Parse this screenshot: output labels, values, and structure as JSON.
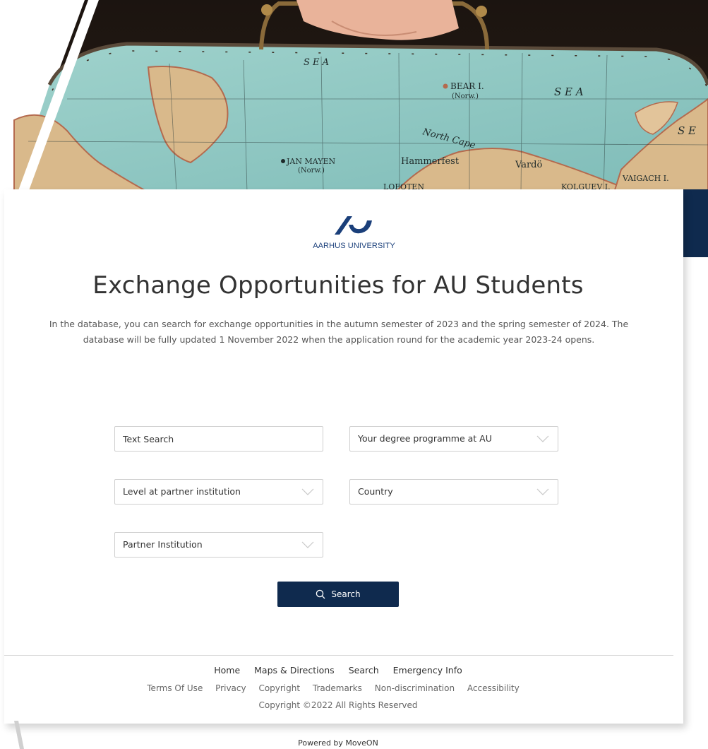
{
  "hero": {
    "image_description_icon": "vintage-map-suitcase-image",
    "map_labels": {
      "sea_top": "S E A",
      "bear_island": "BEAR I.",
      "bear_island_sub": "(Norw.)",
      "sea_right": "S E A",
      "se_right": "S E",
      "north_cape": "North Cape",
      "jan_mayen": "JAN MAYEN",
      "jan_mayen_sub": "(Norw.)",
      "hammerfest": "Hammerfest",
      "vardo": "Vardö",
      "vaigach": "VAIGACH I.",
      "lofoten": "LOFOTEN",
      "kolguev": "KOLGUEV I."
    }
  },
  "brand": {
    "logo_icon": "aarhus-university-logo-icon",
    "name": "AARHUS UNIVERSITY"
  },
  "page": {
    "title": "Exchange Opportunities for AU Students",
    "intro": "In the database, you can search for exchange opportunities in the autumn semester of 2023 and the spring semester of 2024. The database will be fully updated 1 November 2022 when the application round for the academic year 2023-24 opens."
  },
  "search": {
    "text_placeholder": "Text Search",
    "degree_programme": "Your degree programme at AU",
    "level": "Level at partner institution",
    "country": "Country",
    "partner_institution": "Partner Institution",
    "button_label": "Search",
    "button_icon": "search-icon",
    "dropdown_icon": "chevron-down-icon"
  },
  "footer": {
    "nav": [
      "Home",
      "Maps & Directions",
      "Search",
      "Emergency Info"
    ],
    "legal": [
      "Terms Of Use",
      "Privacy",
      "Copyright",
      "Trademarks",
      "Non-discrimination",
      "Accessibility"
    ],
    "copyright": "Copyright ©2022 All Rights Reserved",
    "powered_by": "Powered by MoveON"
  },
  "colors": {
    "brand_navy": "#0f2a4e",
    "logo_blue": "#1a3f7a",
    "map_sea": "#8ec9c4",
    "map_land": "#d9b98b"
  }
}
